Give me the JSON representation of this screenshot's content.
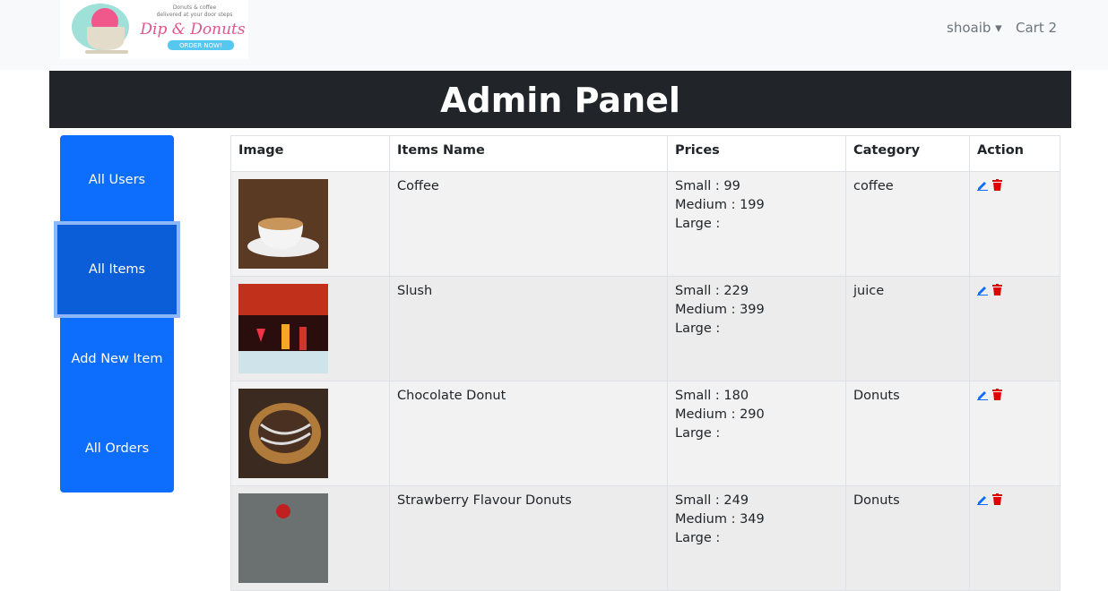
{
  "navbar": {
    "logo_text": "Dip & Donuts",
    "logo_tagline": "Donuts & coffee delivered at your door steps",
    "logo_cta": "ORDER NOW!",
    "user": "shoaib",
    "cart": "Cart 2"
  },
  "banner": {
    "title": "Admin Panel"
  },
  "sidebar": {
    "items": [
      {
        "label": "All Users"
      },
      {
        "label": "All Items"
      },
      {
        "label": "Add New Item"
      },
      {
        "label": "All Orders"
      }
    ]
  },
  "table": {
    "headers": [
      "Image",
      "Items Name",
      "Prices",
      "Category",
      "Action"
    ],
    "rows": [
      {
        "name": "Coffee",
        "small": "Small : 99",
        "medium": "Medium : 199",
        "large": "Large :",
        "category": "coffee"
      },
      {
        "name": "Slush",
        "small": "Small : 229",
        "medium": "Medium : 399",
        "large": "Large :",
        "category": "juice"
      },
      {
        "name": "Chocolate Donut",
        "small": "Small : 180",
        "medium": "Medium : 290",
        "large": "Large :",
        "category": "Donuts"
      },
      {
        "name": "Strawberry Flavour Donuts",
        "small": "Small : 249",
        "medium": "Medium : 349",
        "large": "Large :",
        "category": "Donuts"
      }
    ]
  },
  "colors": {
    "primary": "#0d6efd",
    "dark": "#212529",
    "danger": "#e00000"
  }
}
